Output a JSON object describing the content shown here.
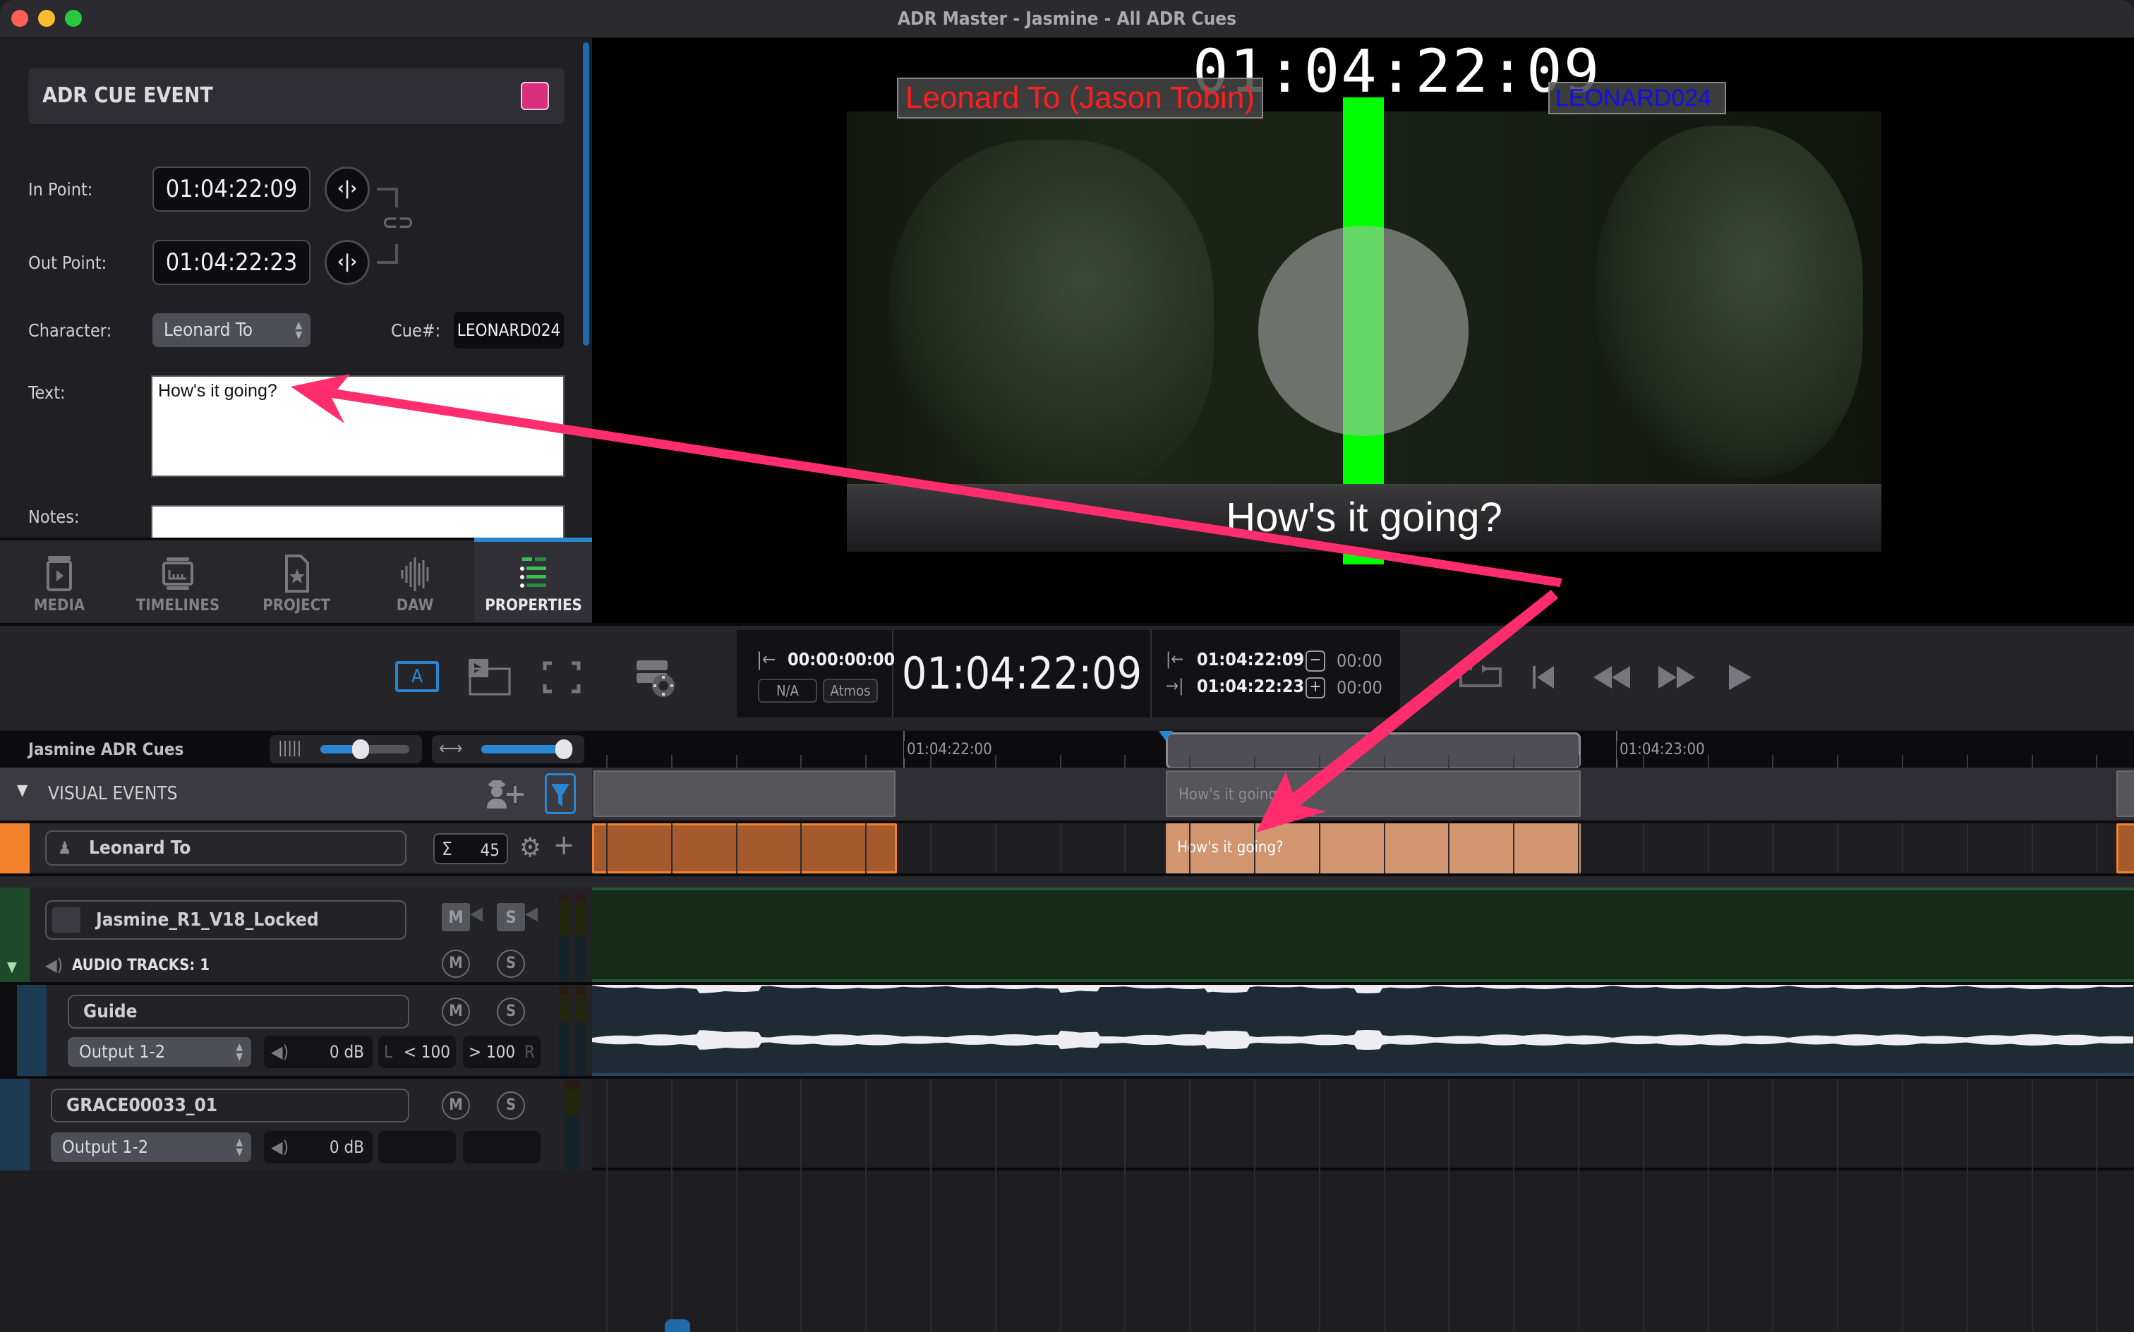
{
  "window": {
    "title": "ADR Master - Jasmine - All ADR Cues",
    "traffic_lights": {
      "close": "#fe5f57",
      "minimize": "#febc2e",
      "zoom": "#28c840"
    }
  },
  "cue_event": {
    "header": "ADR CUE EVENT",
    "color": "#d9307d",
    "in_point_label": "In Point:",
    "in_point": "01:04:22:09",
    "out_point_label": "Out Point:",
    "out_point": "01:04:22:23",
    "character_label": "Character:",
    "character": "Leonard To",
    "cue_label": "Cue#:",
    "cue_number": "LEONARD024",
    "text_label": "Text:",
    "text": "How's it going?",
    "notes_label": "Notes:",
    "notes": ""
  },
  "bottom_tabs": [
    {
      "label": "MEDIA",
      "icon": "media-icon",
      "active": false
    },
    {
      "label": "TIMELINES",
      "icon": "timelines-icon",
      "active": false
    },
    {
      "label": "PROJECT",
      "icon": "project-icon",
      "active": false
    },
    {
      "label": "DAW",
      "icon": "daw-icon",
      "active": false
    },
    {
      "label": "PROPERTIES",
      "icon": "properties-icon",
      "active": true
    }
  ],
  "video": {
    "burnin_timecode": "01:04:22:09",
    "character_overlay": "Leonard To (Jason Tobin)",
    "cue_overlay": "LEONARD024",
    "subtitle": "How's it going?",
    "streamer_color": "#00ff00"
  },
  "transport": {
    "offset_timecode": "00:00:00:00",
    "na_button": "N/A",
    "atmos_button": "Atmos",
    "main_timecode": "01:04:22:09",
    "in_timecode": "01:04:22:09",
    "out_timecode": "01:04:22:23",
    "pre_roll": "00:00",
    "post_roll": "00:00"
  },
  "timeline": {
    "name": "Jasmine ADR Cues",
    "waveform_zoom": 0.45,
    "horizontal_zoom": 0.9,
    "ruler_labels": [
      "01:04:22:00",
      "01:04:23:00"
    ],
    "visual_events_label": "VISUAL EVENTS",
    "visual_event_text": "How's it going?",
    "character_row": {
      "name": "Leonard To",
      "count_symbol": "Σ",
      "count": "45",
      "color": "#f4812b"
    },
    "cue_clip_text": "How's it going?"
  },
  "tracks": {
    "video": {
      "name": "Jasmine_R1_V18_Locked",
      "audio_tracks_label": "AUDIO TRACKS: 1",
      "mute": "M",
      "solo": "S"
    },
    "audio": [
      {
        "name": "Guide",
        "output": "Output 1-2",
        "volume": "0 dB",
        "pan_left_label": "L",
        "pan_left": "< 100",
        "pan_right": "> 100",
        "pan_right_label": "R",
        "mute": "M",
        "solo": "S"
      },
      {
        "name": "GRACE00033_01",
        "output": "Output 1-2",
        "volume": "0 dB",
        "mute": "M",
        "solo": "S"
      }
    ]
  }
}
